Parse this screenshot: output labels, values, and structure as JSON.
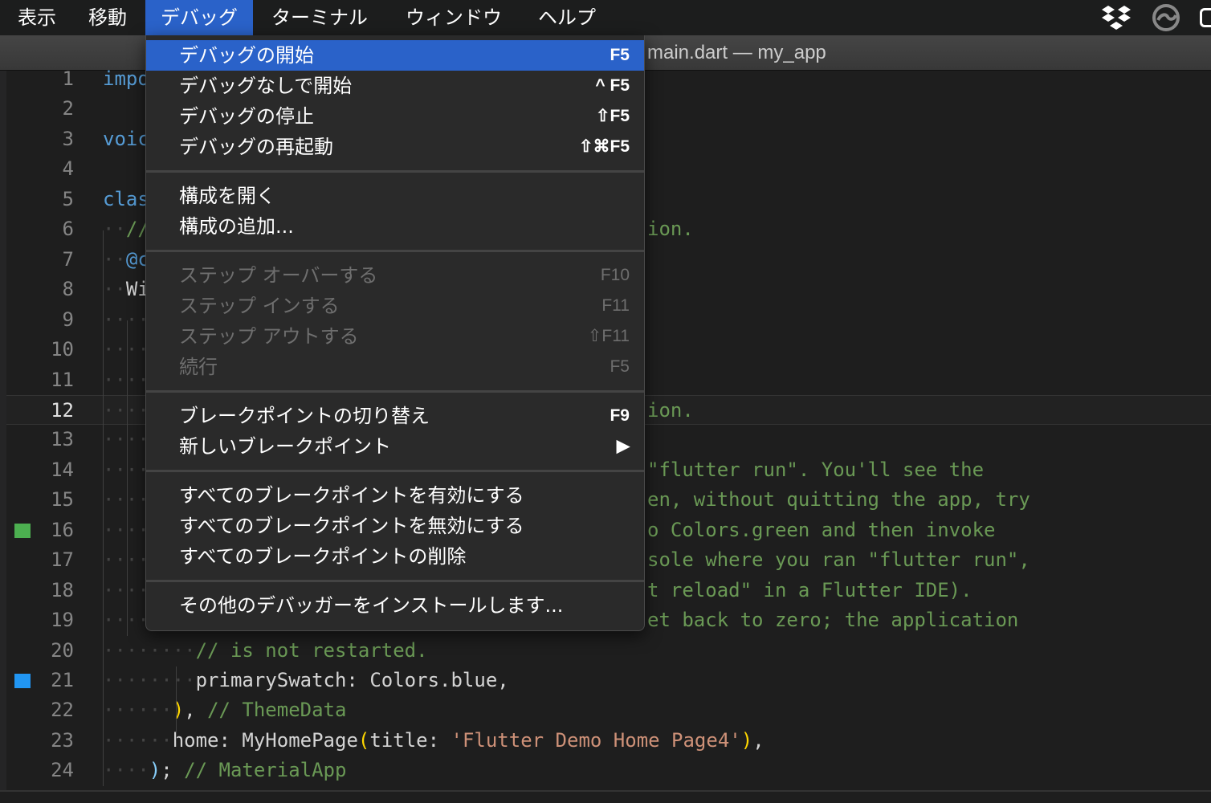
{
  "menubar": {
    "items": [
      "表示",
      "移動",
      "デバッグ",
      "ターミナル",
      "ウィンドウ",
      "ヘルプ"
    ],
    "active": "デバッグ"
  },
  "tray": {
    "icons": [
      "dropbox-icon",
      "creative-cloud-icon"
    ]
  },
  "window": {
    "title": "main.dart — my_app"
  },
  "colors": {
    "accent": "#2a62c9",
    "comment": "#6a9955",
    "keyword": "#569cd6",
    "string": "#ce9178",
    "bracket": "#ffd700",
    "marker_green": "#4caf50",
    "marker_blue": "#2196f3"
  },
  "debug_menu": {
    "groups": [
      [
        {
          "label": "デバッグの開始",
          "shortcut": "F5",
          "highlighted": true
        },
        {
          "label": "デバッグなしで開始",
          "shortcut": "^ F5"
        },
        {
          "label": "デバッグの停止",
          "shortcut": "⇧F5"
        },
        {
          "label": "デバッグの再起動",
          "shortcut": "⇧⌘F5"
        }
      ],
      [
        {
          "label": "構成を開く",
          "shortcut": ""
        },
        {
          "label": "構成の追加...",
          "shortcut": ""
        }
      ],
      [
        {
          "label": "ステップ オーバーする",
          "shortcut": "F10",
          "disabled": true
        },
        {
          "label": "ステップ インする",
          "shortcut": "F11",
          "disabled": true
        },
        {
          "label": "ステップ アウトする",
          "shortcut": "⇧F11",
          "disabled": true
        },
        {
          "label": "続行",
          "shortcut": "F5",
          "disabled": true
        }
      ],
      [
        {
          "label": "ブレークポイントの切り替え",
          "shortcut": "F9"
        },
        {
          "label": "新しいブレークポイント",
          "shortcut": "▶"
        }
      ],
      [
        {
          "label": "すべてのブレークポイントを有効にする",
          "shortcut": ""
        },
        {
          "label": "すべてのブレークポイントを無効にする",
          "shortcut": ""
        },
        {
          "label": "すべてのブレークポイントの削除",
          "shortcut": ""
        }
      ],
      [
        {
          "label": "その他のデバッガーをインストールします...",
          "shortcut": ""
        }
      ]
    ]
  },
  "editor": {
    "current_line": 12,
    "lines": [
      {
        "n": 1,
        "indent": 0,
        "left": [
          [
            "kw",
            "impo"
          ]
        ]
      },
      {
        "n": 2,
        "indent": 0,
        "left": []
      },
      {
        "n": 3,
        "indent": 0,
        "left": [
          [
            "kw",
            "voic"
          ]
        ]
      },
      {
        "n": 4,
        "indent": 0,
        "left": []
      },
      {
        "n": 5,
        "indent": 0,
        "left": [
          [
            "kw",
            "clas"
          ]
        ]
      },
      {
        "n": 6,
        "indent": 2,
        "left": [
          [
            "cm",
            "//"
          ]
        ],
        "right": [
          [
            "cm",
            "ion."
          ]
        ]
      },
      {
        "n": 7,
        "indent": 2,
        "left": [
          [
            "kw",
            "@c"
          ]
        ]
      },
      {
        "n": 8,
        "indent": 2,
        "left": [
          [
            "tx",
            "Wi"
          ]
        ]
      },
      {
        "n": 9,
        "indent": 4,
        "left": []
      },
      {
        "n": 10,
        "indent": 4,
        "left": []
      },
      {
        "n": 11,
        "indent": 4,
        "left": []
      },
      {
        "n": 12,
        "indent": 4,
        "left": [],
        "right": [
          [
            "cm",
            "ion."
          ]
        ]
      },
      {
        "n": 13,
        "indent": 4,
        "left": []
      },
      {
        "n": 14,
        "indent": 4,
        "left": [],
        "right": [
          [
            "cm",
            "\"flutter run\". You'll see the"
          ]
        ]
      },
      {
        "n": 15,
        "indent": 4,
        "left": [],
        "right": [
          [
            "cm",
            "en, without quitting the app, try"
          ]
        ]
      },
      {
        "n": 16,
        "indent": 4,
        "left": [],
        "right": [
          [
            "cm",
            "o Colors.green and then invoke"
          ]
        ],
        "marker": "green"
      },
      {
        "n": 17,
        "indent": 4,
        "left": [],
        "right": [
          [
            "cm",
            "sole where you ran \"flutter run\","
          ]
        ]
      },
      {
        "n": 18,
        "indent": 4,
        "left": [],
        "right": [
          [
            "cm",
            "t reload\" in a Flutter IDE)."
          ]
        ]
      },
      {
        "n": 19,
        "indent": 4,
        "left": [],
        "right": [
          [
            "cm",
            "et back to zero; the application"
          ]
        ]
      },
      {
        "n": 20,
        "indent": 8,
        "left": [
          [
            "cm",
            "// is not restarted."
          ]
        ]
      },
      {
        "n": 21,
        "indent": 8,
        "left": [
          [
            "tx",
            "primarySwatch: Colors.blue,"
          ]
        ],
        "marker": "blue"
      },
      {
        "n": 22,
        "indent": 6,
        "left": [
          [
            "br",
            ")"
          ],
          [
            "tx",
            ", "
          ],
          [
            "cm",
            "// ThemeData"
          ]
        ]
      },
      {
        "n": 23,
        "indent": 6,
        "left": [
          [
            "tx",
            "home: MyHomePage"
          ],
          [
            "br",
            "("
          ],
          [
            "tx",
            "title: "
          ],
          [
            "st",
            "'Flutter Demo Home Page4'"
          ],
          [
            "br",
            ")"
          ],
          [
            "tx",
            ","
          ]
        ]
      },
      {
        "n": 24,
        "indent": 4,
        "left": [
          [
            "br2",
            ")"
          ],
          [
            "tx",
            "; "
          ],
          [
            "cm",
            "// MaterialApp"
          ]
        ]
      }
    ]
  }
}
